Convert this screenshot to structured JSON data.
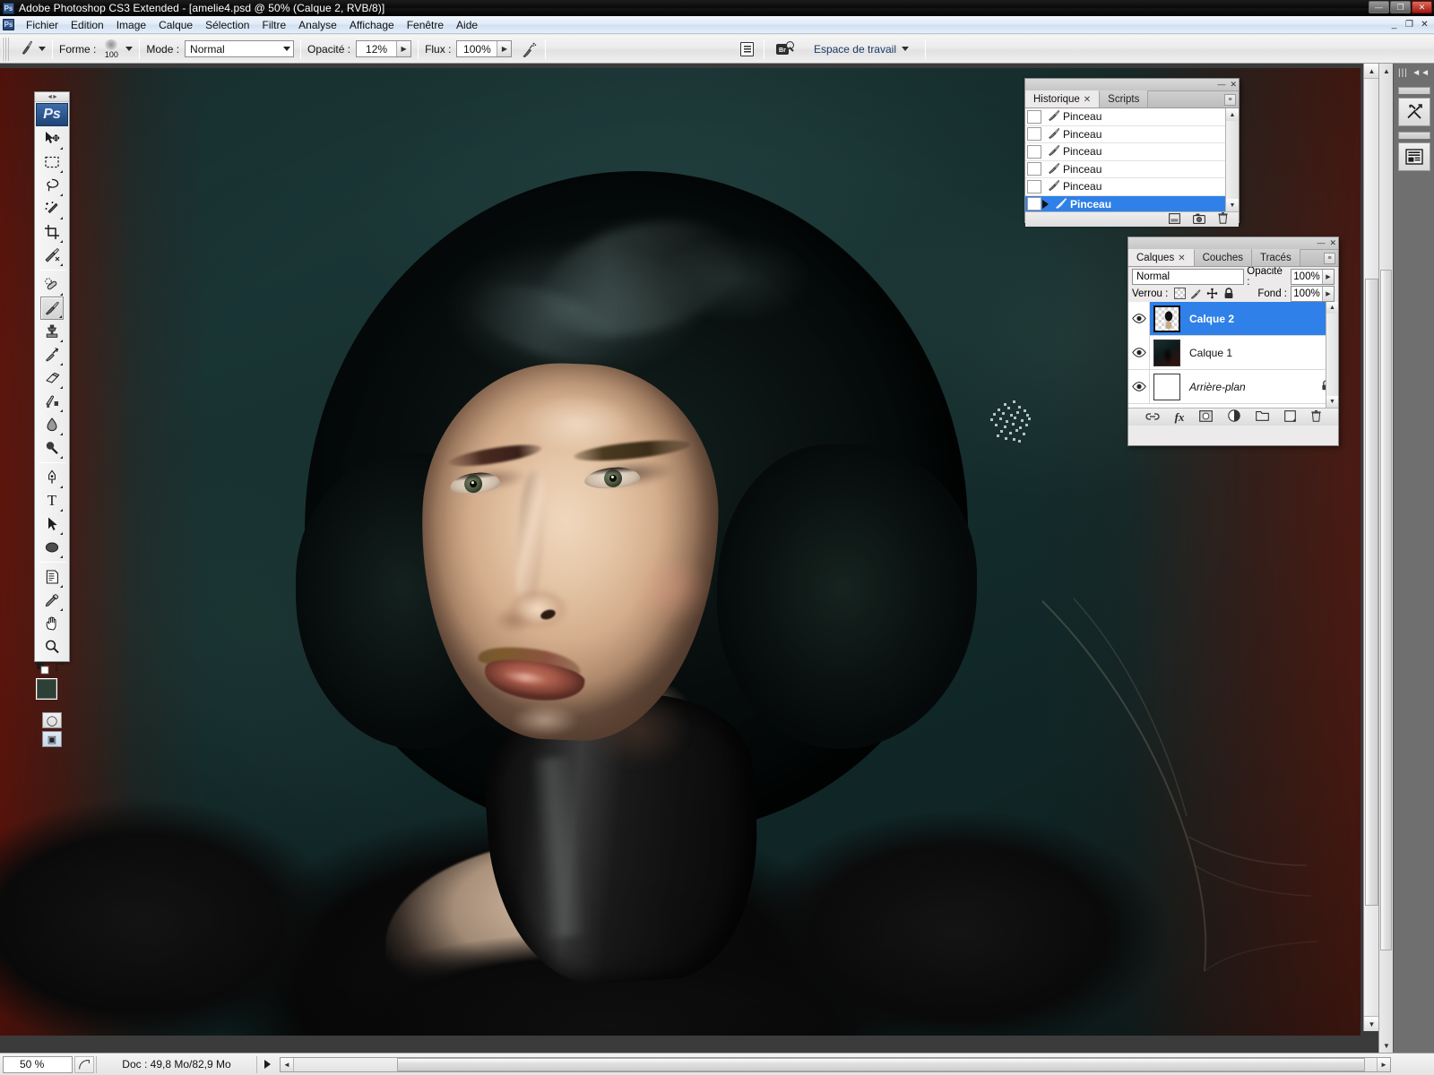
{
  "window": {
    "app_title": "Adobe Photoshop CS3 Extended - [amelie4.psd @ 50% (Calque 2, RVB/8)]",
    "app_icon": "Ps",
    "minimize": "—",
    "maximize": "❐",
    "close": "✕"
  },
  "menubar": {
    "doc_icon": "Ps",
    "items": [
      {
        "label": "Fichier"
      },
      {
        "label": "Edition"
      },
      {
        "label": "Image"
      },
      {
        "label": "Calque"
      },
      {
        "label": "Sélection"
      },
      {
        "label": "Filtre"
      },
      {
        "label": "Analyse"
      },
      {
        "label": "Affichage"
      },
      {
        "label": "Fenêtre"
      },
      {
        "label": "Aide"
      }
    ],
    "doc_minimize": "_",
    "doc_restore": "❐",
    "doc_close": "✕"
  },
  "options_bar": {
    "brush_label": "Forme :",
    "brush_size": "100",
    "mode_label": "Mode :",
    "mode_value": "Normal",
    "opacity_label": "Opacité :",
    "opacity_value": "12%",
    "flow_label": "Flux :",
    "flow_value": "100%",
    "airbrush_name": "airbrush-toggle",
    "palette_name": "toggle-palettes",
    "bridge_label": "Br",
    "workspace_label": "Espace de travail"
  },
  "toolbox": {
    "logo": "Ps",
    "tools": [
      {
        "name": "move-tool",
        "glyph": "✥"
      },
      {
        "name": "rectangular-marquee-tool",
        "glyph": "▭"
      },
      {
        "name": "lasso-tool",
        "glyph": "◌"
      },
      {
        "name": "magic-wand-tool",
        "glyph": "✦"
      },
      {
        "name": "crop-tool",
        "glyph": "⌗"
      },
      {
        "name": "slice-tool",
        "glyph": "✂"
      },
      {
        "name": "healing-brush-tool",
        "glyph": "✎"
      },
      {
        "name": "brush-tool",
        "glyph": "🖌"
      },
      {
        "name": "clone-stamp-tool",
        "glyph": "⎚"
      },
      {
        "name": "history-brush-tool",
        "glyph": "✐"
      },
      {
        "name": "eraser-tool",
        "glyph": "▱"
      },
      {
        "name": "gradient-tool",
        "glyph": "◨"
      },
      {
        "name": "blur-tool",
        "glyph": "💧"
      },
      {
        "name": "dodge-tool",
        "glyph": "⦿"
      },
      {
        "name": "pen-tool",
        "glyph": "✒"
      },
      {
        "name": "type-tool",
        "glyph": "T"
      },
      {
        "name": "path-selection-tool",
        "glyph": "➤"
      },
      {
        "name": "ellipse-shape-tool",
        "glyph": "⬭"
      },
      {
        "name": "notes-tool",
        "glyph": "▤"
      },
      {
        "name": "eyedropper-tool",
        "glyph": "⚲"
      },
      {
        "name": "hand-tool",
        "glyph": "✋"
      },
      {
        "name": "zoom-tool",
        "glyph": "🔍"
      }
    ],
    "foreground_color": "#2c4036",
    "background_color": "#32473b",
    "quickmask_glyph": "◯",
    "screenmode_glyph": "▣"
  },
  "history_panel": {
    "tabs": [
      {
        "label": "Historique",
        "closable": true,
        "active": true
      },
      {
        "label": "Scripts",
        "closable": false,
        "active": false
      }
    ],
    "states": [
      {
        "label": "Pinceau",
        "selected": false
      },
      {
        "label": "Pinceau",
        "selected": false
      },
      {
        "label": "Pinceau",
        "selected": false
      },
      {
        "label": "Pinceau",
        "selected": false
      },
      {
        "label": "Pinceau",
        "selected": false
      },
      {
        "label": "Pinceau",
        "selected": true
      }
    ],
    "footer_buttons": [
      {
        "name": "create-document-from-state-button",
        "glyph": "▤"
      },
      {
        "name": "create-new-snapshot-button",
        "glyph": "▣"
      },
      {
        "name": "delete-state-button",
        "glyph": "🗑"
      }
    ]
  },
  "layers_panel": {
    "tabs": [
      {
        "label": "Calques",
        "closable": true,
        "active": true
      },
      {
        "label": "Couches",
        "closable": false,
        "active": false
      },
      {
        "label": "Tracés",
        "closable": false,
        "active": false
      }
    ],
    "blend_mode": "Normal",
    "opacity_label": "Opacité :",
    "opacity_value": "100%",
    "lock_label": "Verrou :",
    "fill_label": "Fond :",
    "fill_value": "100%",
    "layers": [
      {
        "name": "Calque 2",
        "selected": true,
        "visible": true,
        "locked": false,
        "italic": false
      },
      {
        "name": "Calque 1",
        "selected": false,
        "visible": true,
        "locked": false,
        "italic": false
      },
      {
        "name": "Arrière-plan",
        "selected": false,
        "visible": true,
        "locked": true,
        "italic": true
      }
    ],
    "footer_buttons": [
      {
        "name": "link-layers-button",
        "glyph": "⛓"
      },
      {
        "name": "layer-style-button",
        "glyph": "fx"
      },
      {
        "name": "layer-mask-button",
        "glyph": "◻"
      },
      {
        "name": "adjustment-layer-button",
        "glyph": "◐"
      },
      {
        "name": "new-group-button",
        "glyph": "🗀"
      },
      {
        "name": "new-layer-button",
        "glyph": "⧉"
      },
      {
        "name": "delete-layer-button",
        "glyph": "🗑"
      }
    ]
  },
  "right_dock": {
    "collapse_glyph": "◄◄",
    "grip_glyph": "|||",
    "buttons": [
      {
        "name": "tool-presets-button",
        "glyph": "✂"
      },
      {
        "name": "layer-comps-button",
        "glyph": "▤"
      }
    ]
  },
  "status_bar": {
    "zoom_value": "50 %",
    "doc_info": "Doc : 49,8 Mo/82,9 Mo"
  },
  "canvas": {
    "title": "amelie4.psd",
    "zoom": "50%",
    "active_layer": "Calque 2",
    "color_mode": "RVB/8",
    "background_teal": "#16302f",
    "background_maroon": "#6c140a",
    "skin_color": "#e5c6a7",
    "hair_color": "#0b1413",
    "lip_color": "#a85a49",
    "eye_color": "#515c44"
  }
}
